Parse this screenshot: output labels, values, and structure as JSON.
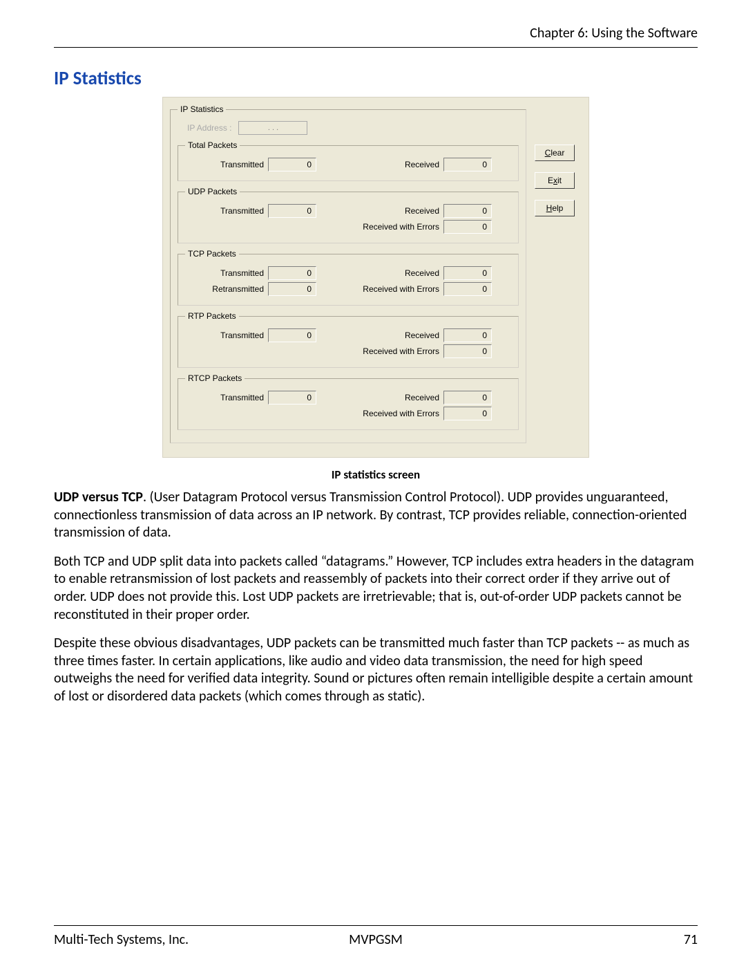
{
  "header": {
    "chapter": "Chapter 6: Using the Software"
  },
  "section_title": "IP Statistics",
  "panel": {
    "title": "IP Statistics",
    "ip_address_label": "IP Address :",
    "ip_dots": ".   .   .",
    "buttons": {
      "clear": "Clear",
      "exit": "Exit",
      "help": "Help"
    },
    "groups": {
      "total": {
        "legend": "Total Packets",
        "transmitted_label": "Transmitted",
        "transmitted": "0",
        "received_label": "Received",
        "received": "0"
      },
      "udp": {
        "legend": "UDP Packets",
        "transmitted_label": "Transmitted",
        "transmitted": "0",
        "received_label": "Received",
        "received": "0",
        "rcv_err_label": "Received with Errors",
        "rcv_err": "0"
      },
      "tcp": {
        "legend": "TCP Packets",
        "transmitted_label": "Transmitted",
        "transmitted": "0",
        "received_label": "Received",
        "received": "0",
        "retransmitted_label": "Retransmitted",
        "retransmitted": "0",
        "rcv_err_label": "Received with Errors",
        "rcv_err": "0"
      },
      "rtp": {
        "legend": "RTP Packets",
        "transmitted_label": "Transmitted",
        "transmitted": "0",
        "received_label": "Received",
        "received": "0",
        "rcv_err_label": "Received with Errors",
        "rcv_err": "0"
      },
      "rtcp": {
        "legend": "RTCP Packets",
        "transmitted_label": "Transmitted",
        "transmitted": "0",
        "received_label": "Received",
        "received": "0",
        "rcv_err_label": "Received with Errors",
        "rcv_err": "0"
      }
    }
  },
  "caption": "IP statistics screen",
  "paragraphs": {
    "p1_bold": "UDP versus TCP",
    "p1_rest": ".  (User Datagram Protocol versus Transmission Control Protocol).  UDP provides unguaranteed, connectionless transmission of data across an IP network. By contrast, TCP provides reliable, connection-oriented transmission of data.",
    "p2": "Both TCP and UDP split data into packets called “datagrams.”  However, TCP includes extra headers in the datagram to enable retransmission of lost packets and reassembly of packets into their correct order if they arrive out of order.  UDP does not provide this.  Lost UDP packets are irretrievable; that is, out-of-order UDP packets cannot be reconstituted in their proper order.",
    "p3": "Despite these obvious disadvantages, UDP packets can be transmitted much faster than TCP packets -- as much as three times faster. In certain applications, like audio and video data transmission, the need for high speed outweighs the need for verified data integrity.  Sound or pictures often remain intelligible despite a certain amount of lost or disordered data packets (which comes through as static)."
  },
  "footer": {
    "left": "Multi-Tech Systems, Inc.",
    "center": "MVPGSM",
    "right": "71"
  }
}
